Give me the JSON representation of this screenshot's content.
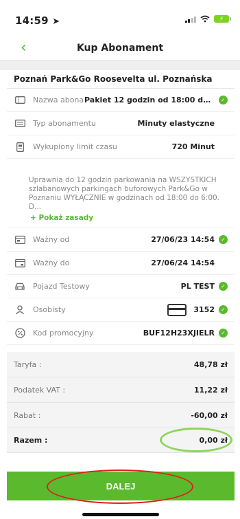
{
  "status": {
    "time": "14:59",
    "arrow": "➤"
  },
  "nav": {
    "back": "‹",
    "title": "Kup Abonament"
  },
  "location": "Poznań Park&Go Roosevelta ul. Poznańska",
  "rows": [
    {
      "icon": "ticket-icon",
      "label": "Nazwa abonamentu",
      "value": "Pakiet 12 godzin od 18:00 do...",
      "checked": true
    },
    {
      "icon": "list-icon",
      "label": "Typ abonamentu",
      "value": "Minuty elastyczne",
      "checked": false
    },
    {
      "icon": "clock-card-icon",
      "label": "Wykupiony limit czasu",
      "value": "720 Minut",
      "checked": false
    }
  ],
  "description": {
    "text": "Uprawnia do 12 godzin parkowania na WSZYSTKICH szlabanowych parkingach buforowych Park&Go w Poznaniu WYŁĄCZNIE w godzinach od 18:00 do 6:00. D...",
    "more": "+ Pokaż zasady"
  },
  "validity": [
    {
      "icon": "calendar-start-icon",
      "label": "Ważny od",
      "value": "27/06/23 14:54",
      "checked": true
    },
    {
      "icon": "calendar-end-icon",
      "label": "Ważny do",
      "value": "27/06/24 14:54",
      "checked": false
    },
    {
      "icon": "car-icon",
      "label": "Pojazd Testowy",
      "value": "PL TEST",
      "checked": true
    },
    {
      "icon": "person-icon",
      "label": "Osobisty",
      "value": "3152",
      "checked": true
    },
    {
      "icon": "percent-icon",
      "label": "Kod promocyjny",
      "value": "BUF12H23XJIELR",
      "checked": true
    }
  ],
  "totals": [
    {
      "label": "Taryfa :",
      "value": "48,78 zł"
    },
    {
      "label": "Podatek VAT :",
      "value": "11,22 zł"
    },
    {
      "label": "Rabat :",
      "value": "-60,00 zł"
    },
    {
      "label": "Razem :",
      "value": "0,00 zł"
    }
  ],
  "cta": "DALEJ",
  "colors": {
    "accent": "#5ab92c",
    "highlight_green": "#8fd45d",
    "highlight_red": "#e02020"
  }
}
